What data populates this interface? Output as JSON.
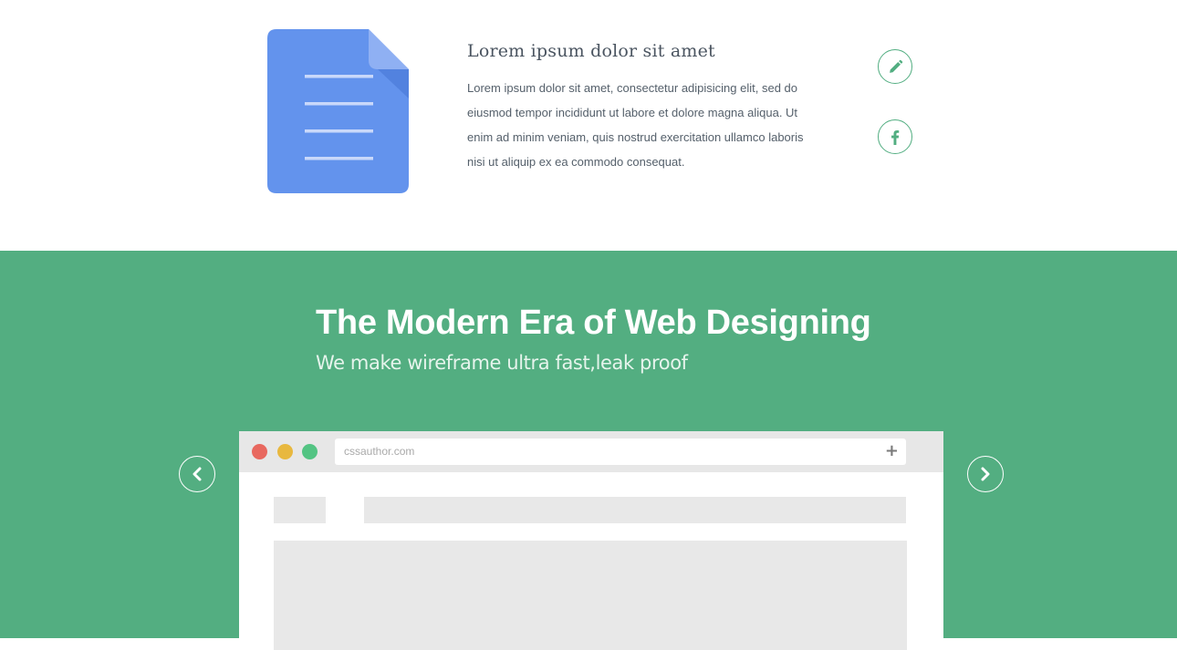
{
  "feature": {
    "icon": "document-icon",
    "title": "Lorem ipsum dolor sit amet",
    "text": "Lorem ipsum dolor sit amet, consectetur adipisicing elit, sed do eiusmod tempor incididunt ut labore et dolore magna aliqua. Ut enim ad minim veniam, quis nostrud exercitation ullamco laboris nisi ut aliquip ex ea commodo consequat.",
    "actions": [
      {
        "name": "edit",
        "icon": "pencil-icon"
      },
      {
        "name": "facebook",
        "icon": "facebook-icon"
      }
    ]
  },
  "hero": {
    "title": "The Modern Era of Web Designing",
    "subtitle": "We make wireframe ultra fast,leak proof",
    "prev_icon": "chevron-left-icon",
    "next_icon": "chevron-right-icon"
  },
  "browser": {
    "url": "cssauthor.com",
    "add_icon": "+"
  },
  "colors": {
    "accent_green": "#53ae81",
    "doc_blue": "#6393ed",
    "dot_red": "#e8685f",
    "dot_yellow": "#e8b83f",
    "dot_green": "#53c483"
  }
}
